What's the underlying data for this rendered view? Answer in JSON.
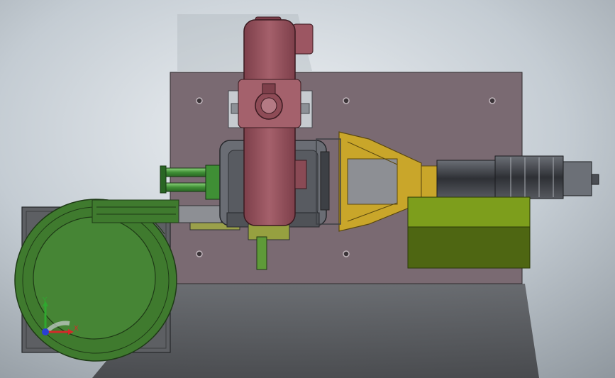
{
  "colors": {
    "background_light": "#e6eaee",
    "background_dark": "#46484c",
    "base_plate": "#7a6a72",
    "bowl_feeder": "#3f7a2e",
    "bowl_feeder_dark": "#2b5220",
    "press_head": "#9c5662",
    "gearbox_yellow": "#c9a62a",
    "motor_dark": "#3a3d42",
    "lime_block": "#6f8f1a",
    "lime_block_dark": "#4e6612",
    "cylinder_green": "#4fa043"
  },
  "triad": {
    "y_label": "Y",
    "x_label": "X",
    "y_color": "#2fa82f",
    "x_color": "#d42a2a",
    "z_color": "#2a3fd4"
  }
}
